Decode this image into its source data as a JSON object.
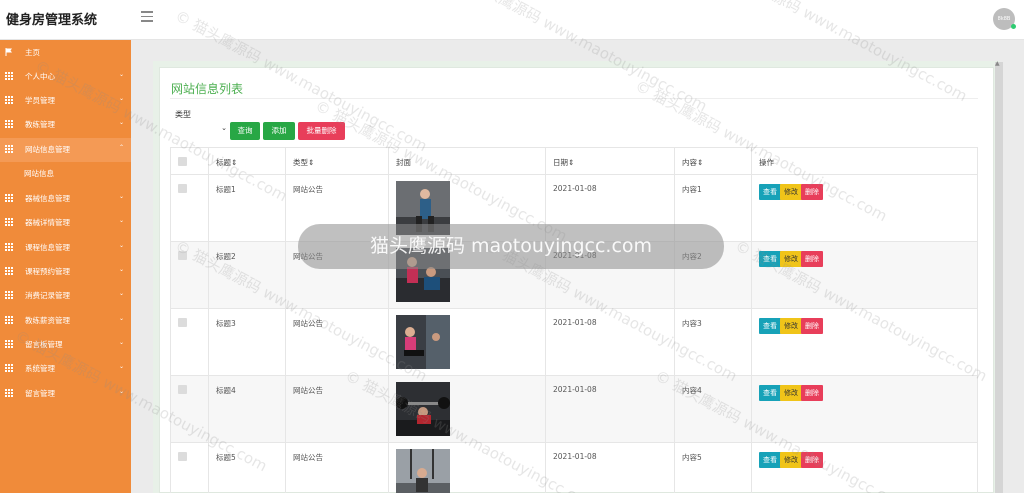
{
  "header": {
    "app_title": "健身房管理系统",
    "avatar_text": "8k8B"
  },
  "sidebar": {
    "items": [
      {
        "label": "主页",
        "icon": "flag-icon",
        "caret": false
      },
      {
        "label": "个人中心",
        "icon": "grid-icon",
        "caret": true
      },
      {
        "label": "学员管理",
        "icon": "grid-icon",
        "caret": true
      },
      {
        "label": "教练管理",
        "icon": "grid-icon",
        "caret": true
      },
      {
        "label": "网站信息管理",
        "icon": "grid-icon",
        "caret": true,
        "active": true
      },
      {
        "label": "器械信息管理",
        "icon": "grid-icon",
        "caret": true
      },
      {
        "label": "器械详情管理",
        "icon": "grid-icon",
        "caret": true
      },
      {
        "label": "课程信息管理",
        "icon": "grid-icon",
        "caret": true
      },
      {
        "label": "课程预约管理",
        "icon": "grid-icon",
        "caret": true
      },
      {
        "label": "消费记录管理",
        "icon": "grid-icon",
        "caret": true
      },
      {
        "label": "教练薪资管理",
        "icon": "grid-icon",
        "caret": true
      },
      {
        "label": "留言板管理",
        "icon": "grid-icon",
        "caret": true
      },
      {
        "label": "系统管理",
        "icon": "grid-icon",
        "caret": true
      },
      {
        "label": "留言管理",
        "icon": "grid-icon",
        "caret": true
      }
    ],
    "sub_item": "网站信息",
    "caret_down": "⌄",
    "caret_up": "⌃"
  },
  "page": {
    "title": "网站信息列表",
    "filter_label": "类型",
    "buttons": {
      "query": "查询",
      "add": "添加",
      "batch_delete": "批量删除"
    }
  },
  "table": {
    "headers": [
      "",
      "标题⇕",
      "类型⇕",
      "封面",
      "日期⇕",
      "内容⇕",
      "操作"
    ],
    "rows": [
      {
        "title": "标题1",
        "type": "网站公告",
        "date": "2021-01-08",
        "content": "内容1"
      },
      {
        "title": "标题2",
        "type": "网站公告",
        "date": "2021-01-08",
        "content": "内容2"
      },
      {
        "title": "标题3",
        "type": "网站公告",
        "date": "2021-01-08",
        "content": "内容3"
      },
      {
        "title": "标题4",
        "type": "网站公告",
        "date": "2021-01-08",
        "content": "内容4"
      },
      {
        "title": "标题5",
        "type": "网站公告",
        "date": "2021-01-08",
        "content": "内容5"
      }
    ],
    "actions": {
      "view": "查看",
      "edit": "修改",
      "delete": "删除"
    }
  },
  "overlay": {
    "banner_text": "猫头鹰源码 maotouyingcc.com",
    "watermark_text": "© 猫头鹰源码 www.maotouyingcc.com"
  },
  "colors": {
    "sidebar": "#f08b3a",
    "title_green": "#4caf50",
    "btn_green": "#28a745",
    "btn_red": "#e83e5a",
    "btn_cyan": "#17a2b8",
    "btn_yellow": "#f0c419"
  }
}
